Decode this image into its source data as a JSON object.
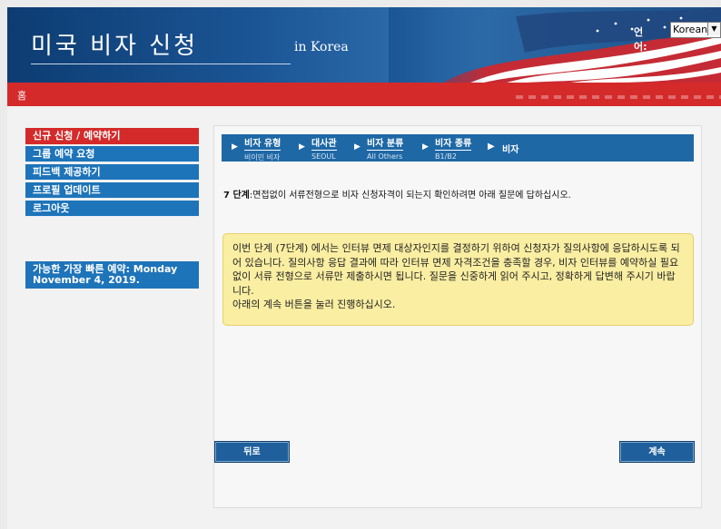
{
  "header": {
    "title": "미국 비자 신청",
    "subtitle": "in Korea",
    "language_label": "언어:",
    "language_value": "Korean"
  },
  "nav": {
    "home": "홈"
  },
  "sidebar": {
    "items": [
      {
        "label": "신규 신청 / 예약하기",
        "active": true
      },
      {
        "label": "그룹 예약 요청",
        "active": false
      },
      {
        "label": "피드백 제공하기",
        "active": false
      },
      {
        "label": "프로필 업데이트",
        "active": false
      },
      {
        "label": "로그아웃",
        "active": false
      }
    ],
    "earliest": "가능한 가장 빠른 예약: Monday November 4, 2019."
  },
  "breadcrumbs": [
    {
      "title": "비자 유형",
      "sub": "비이민 비자"
    },
    {
      "title": "대사관",
      "sub": "SEOUL"
    },
    {
      "title": "비자 분류",
      "sub": "All Others"
    },
    {
      "title": "비자 종류",
      "sub": "B1/B2"
    }
  ],
  "breadcrumb_current": "비자",
  "step": {
    "label": "7 단계",
    "text": ":면접없이 서류전형으로 비자 신청자격이 되는지 확인하려면 아래 질문에 답하십시오."
  },
  "notice": {
    "paragraph": "이번 단계 (7단계) 에서는 인터뷰 면제 대상자인지를 결정하기 위하여 신청자가 질의사항에 응답하시도록 되어 있습니다. 질의사항 응답 결과에 따라 인터뷰 면제 자격조건을 충족할 경우, 비자 인터뷰를 예약하실 필요 없이 서류 전형으로 서류만 제출하시면 됩니다. 질문을 신중하게 읽어 주시고, 정확하게 답변해 주시기 바랍니다.",
    "line2": "아래의 계속 버튼을 눌러 진행하십시오."
  },
  "buttons": {
    "back": "뒤로",
    "next": "계속"
  },
  "colors": {
    "brand_blue": "#1e74b9",
    "brand_red": "#d42a2a",
    "notice_bg": "#faeea2"
  }
}
